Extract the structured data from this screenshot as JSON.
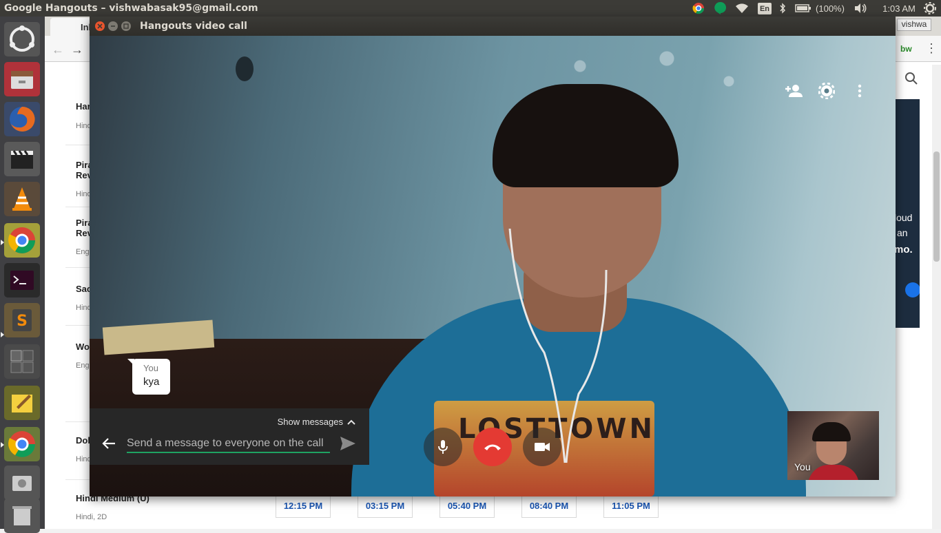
{
  "top_panel": {
    "window_title": "Google Hangouts – vishwabasak95@gmail.com",
    "keyboard_layout": "En",
    "battery": "(100%)",
    "clock": "1:03 AM"
  },
  "browser_bg": {
    "tab_label": "Inb",
    "user_badge": "vishwa",
    "extension_label": "bw",
    "ad_text": [
      "loud",
      "an",
      "mo."
    ],
    "movies": [
      {
        "title": "Har",
        "sub": "Hind"
      },
      {
        "title": "Pira\nRev",
        "sub": "Hind"
      },
      {
        "title": "Pira\nRev",
        "sub": "Eng"
      },
      {
        "title": "Sac",
        "sub": "Hind"
      },
      {
        "title": "Wo",
        "sub": "Eng"
      },
      {
        "title": "Dol",
        "sub": "Hind"
      },
      {
        "title": "Hindi Medium (U)",
        "sub": "Hindi, 2D"
      }
    ],
    "showtimes": [
      "12:15 PM",
      "03:15 PM",
      "05:40 PM",
      "08:40 PM",
      "11:05 PM"
    ]
  },
  "hangouts": {
    "window_title": "Hangouts video call",
    "chat_bubble": {
      "sender": "You",
      "text": "kya"
    },
    "show_messages_label": "Show messages",
    "message_placeholder": "Send a message to everyone on the call",
    "shirt_text": "LOSTTOWN",
    "self_view_label": "You"
  },
  "colors": {
    "hangup_red": "#e43a33",
    "input_underline_green": "#1ea362",
    "panel_dark": "#3c3b37"
  }
}
